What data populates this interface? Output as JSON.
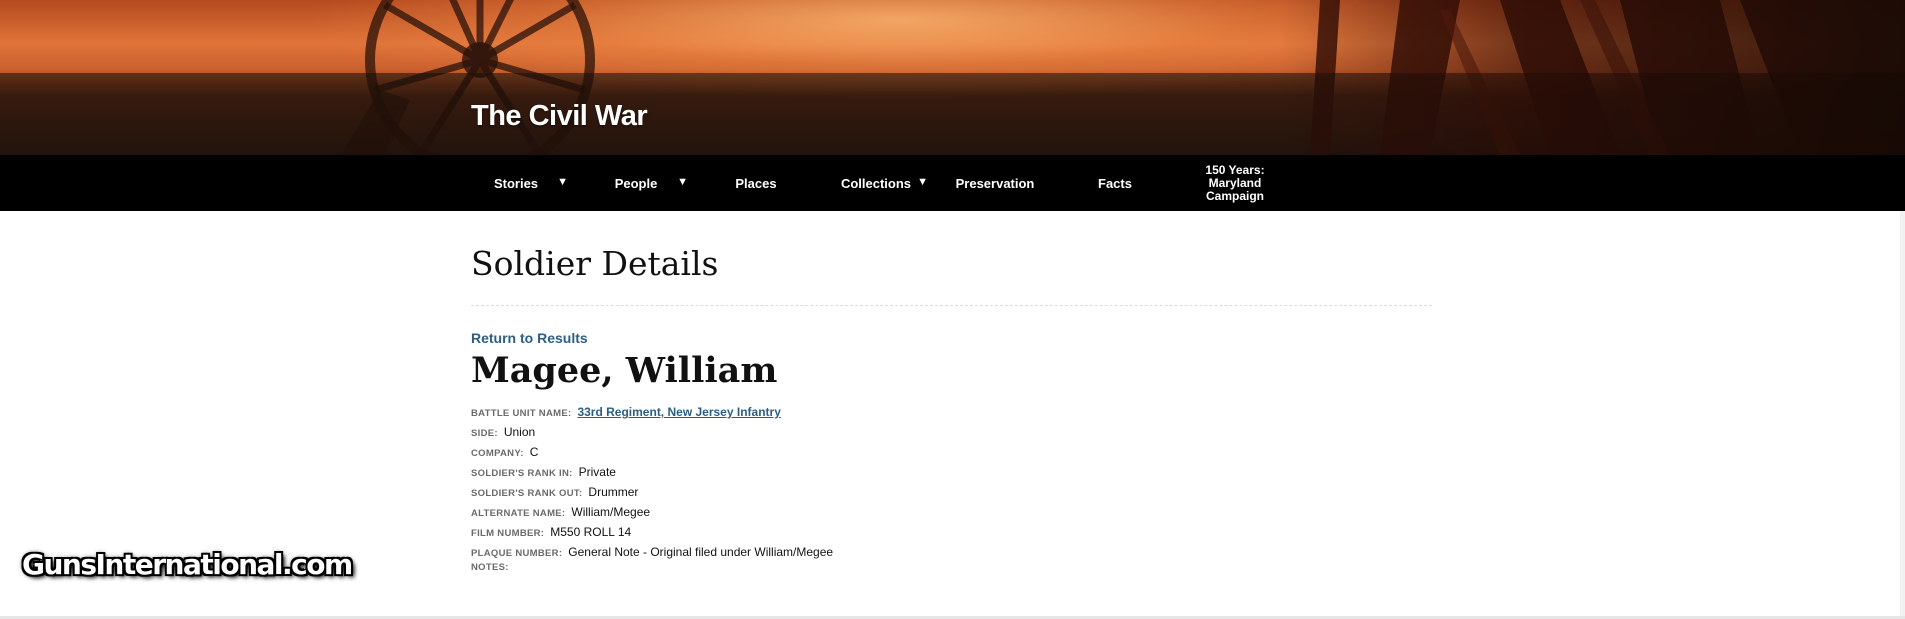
{
  "header": {
    "site_title": "The Civil War"
  },
  "nav": {
    "items": [
      {
        "label": "Stories",
        "has_dropdown": true
      },
      {
        "label": "People",
        "has_dropdown": true
      },
      {
        "label": "Places",
        "has_dropdown": false
      },
      {
        "label": "Collections",
        "has_dropdown": true
      },
      {
        "label": "Preservation",
        "has_dropdown": false
      },
      {
        "label": "Facts",
        "has_dropdown": false
      },
      {
        "label_lines": [
          "150 Years:",
          "Maryland",
          "Campaign"
        ],
        "has_dropdown": false
      }
    ],
    "dropdown_glyph": "▼"
  },
  "main": {
    "page_title": "Soldier Details",
    "return_link": "Return to Results",
    "soldier_name": "Magee, William",
    "details": [
      {
        "label": "BATTLE UNIT NAME:",
        "value": "33rd Regiment, New Jersey Infantry",
        "is_link": true
      },
      {
        "label": "SIDE:",
        "value": "Union"
      },
      {
        "label": "COMPANY:",
        "value": "C"
      },
      {
        "label": "SOLDIER'S RANK IN:",
        "value": "Private"
      },
      {
        "label": "SOLDIER'S RANK OUT:",
        "value": "Drummer"
      },
      {
        "label": "ALTERNATE NAME:",
        "value": "William/Megee"
      },
      {
        "label": "FILM NUMBER:",
        "value": "M550 ROLL 14"
      },
      {
        "label": "PLAQUE NUMBER:",
        "value": "General Note - Original filed under William/Megee"
      },
      {
        "label": "NOTES:",
        "value": ""
      }
    ]
  },
  "watermark": {
    "text": "GunsInternational.com"
  },
  "colors": {
    "nav_bg": "#000000",
    "link": "#2c5f82",
    "label_gray": "#6a6a6a"
  },
  "icons": [
    "dropdown-arrow-icon",
    "cannon-silhouette",
    "plants-silhouette"
  ]
}
